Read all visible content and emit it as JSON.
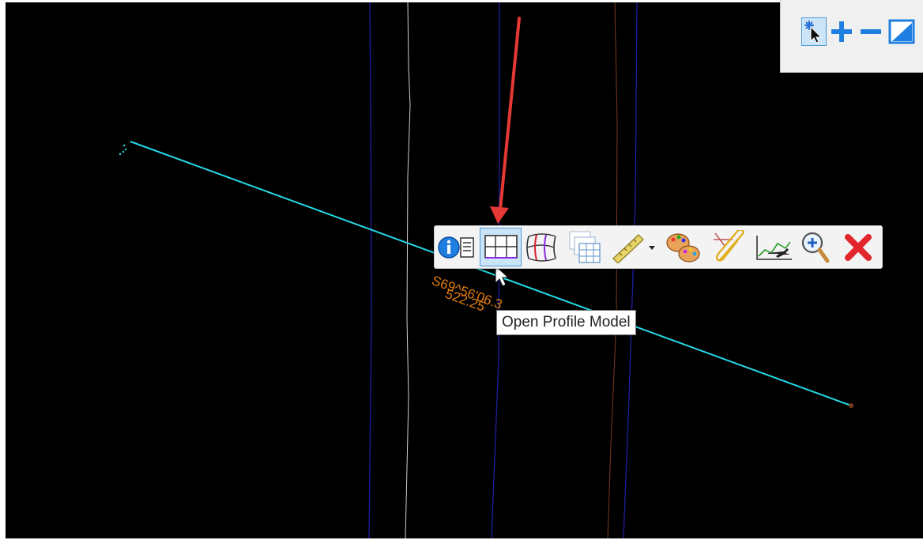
{
  "annotation": {
    "bearing": "S69^56'06.3",
    "distance": "522.25"
  },
  "view_controls": {
    "items": [
      {
        "name": "element-select-icon"
      },
      {
        "name": "zoom-in-icon"
      },
      {
        "name": "zoom-out-icon"
      },
      {
        "name": "fit-view-icon"
      }
    ]
  },
  "context_toolbar": {
    "items": [
      {
        "name": "element-info-icon",
        "active": false
      },
      {
        "name": "open-profile-model-icon",
        "active": true
      },
      {
        "name": "open-3d-model-icon",
        "active": false
      },
      {
        "name": "cross-sections-icon",
        "active": false
      },
      {
        "name": "measure-ruler-icon",
        "active": false
      },
      {
        "name": "dropdown-arrow-icon",
        "active": false
      },
      {
        "name": "palette-icon",
        "active": false
      },
      {
        "name": "attach-paperclip-icon",
        "active": false
      },
      {
        "name": "flyover-icon",
        "active": false
      },
      {
        "name": "zoom-to-icon",
        "active": false
      },
      {
        "name": "close-icon",
        "active": false
      }
    ]
  },
  "tooltip": {
    "text": "Open Profile Model"
  },
  "colors": {
    "background": "#000000",
    "alignment": "#26d8e6",
    "annotation": "#e07a12",
    "arrow": "#e53935",
    "row_lines": "#1e1ea0",
    "accent": "#4a9ad8"
  }
}
